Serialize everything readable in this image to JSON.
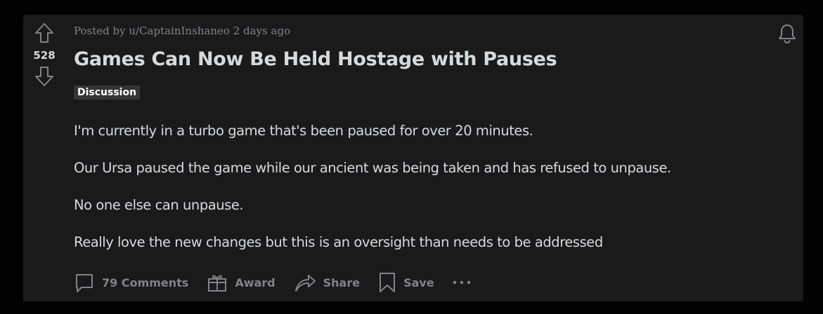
{
  "post": {
    "votes": "528",
    "meta": "Posted by u/CaptainInshaneo 2 days ago",
    "title": "Games Can Now Be Held Hostage with Pauses",
    "flair": "Discussion",
    "body": [
      "I'm currently in a turbo game that's been paused for over 20 minutes.",
      "Our Ursa paused the game while our ancient was being taken and has refused to unpause.",
      "No one else can unpause.",
      "Really love the new changes but this is an oversight than needs to be addressed"
    ]
  },
  "actions": {
    "comments_label": "79 Comments",
    "award_label": "Award",
    "share_label": "Share",
    "save_label": "Save"
  },
  "icons": {
    "upvote": "arrow-up-icon",
    "downvote": "arrow-down-icon",
    "bell": "bell-icon",
    "comments": "comment-bubble-icon",
    "award": "gift-icon",
    "share": "share-arrow-icon",
    "save": "bookmark-icon",
    "more": "more-dots-icon"
  },
  "colors": {
    "background": "#030303",
    "card": "#1a1a1b",
    "text": "#d7dadc",
    "muted": "#818384",
    "flair_bg": "#343536"
  }
}
